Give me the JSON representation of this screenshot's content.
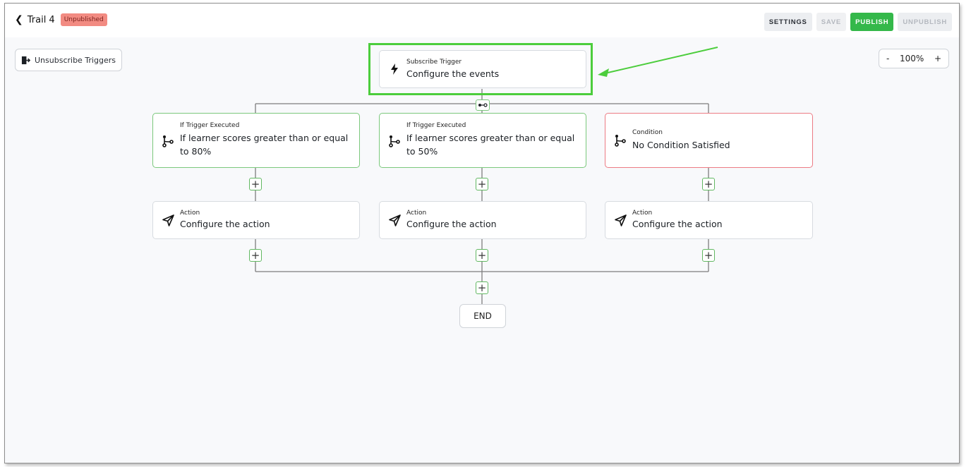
{
  "header": {
    "back_icon": "chevron-left-icon",
    "title": "Trail 4",
    "status_badge": "Unpublished",
    "buttons": {
      "settings": "SETTINGS",
      "save": "SAVE",
      "publish": "PUBLISH",
      "unpublish": "UNPUBLISH"
    }
  },
  "toolbar": {
    "unsubscribe_label": "Unsubscribe Triggers",
    "zoom": {
      "minus": "-",
      "level": "100%",
      "plus": "+"
    }
  },
  "flow": {
    "trigger": {
      "kind": "Subscribe Trigger",
      "label": "Configure the events",
      "icon": "lightning-icon"
    },
    "branches": [
      {
        "kind": "If Trigger Executed",
        "label": "If learner scores greater than or equal to 80%",
        "icon": "branch-icon",
        "status": "valid"
      },
      {
        "kind": "If Trigger Executed",
        "label": "If learner scores greater than or equal to 50%",
        "icon": "branch-icon",
        "status": "valid"
      },
      {
        "kind": "Condition",
        "label": "No Condition Satisfied",
        "icon": "branch-icon",
        "status": "error"
      }
    ],
    "actions": [
      {
        "kind": "Action",
        "label": "Configure the action",
        "icon": "send-icon"
      },
      {
        "kind": "Action",
        "label": "Configure the action",
        "icon": "send-icon"
      },
      {
        "kind": "Action",
        "label": "Configure the action",
        "icon": "send-icon"
      }
    ],
    "add_symbol": "+",
    "end_label": "END"
  },
  "colors": {
    "publish": "#34b84a",
    "badge": "#f28b82",
    "highlight": "#4ccd3c",
    "valid_border": "#7bc87c",
    "error_border": "#ec7b84"
  }
}
